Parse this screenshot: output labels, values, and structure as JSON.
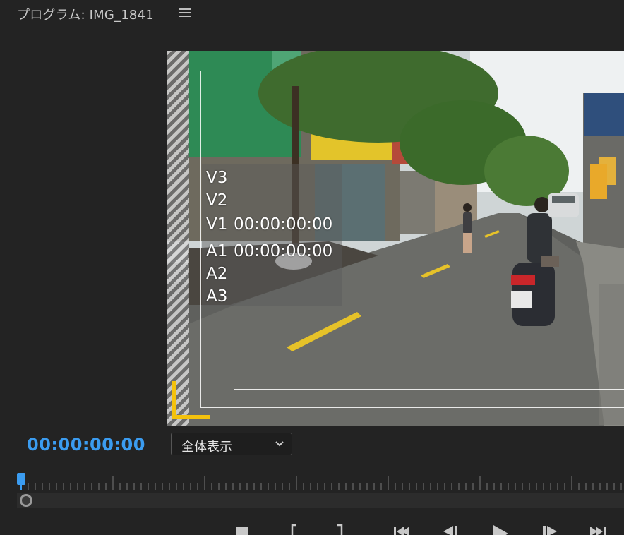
{
  "panel": {
    "title": "プログラム: IMG_1841",
    "menu_icon": "hamburger-menu-icon"
  },
  "monitor": {
    "tracks": [
      {
        "label": "V3",
        "timecode": ""
      },
      {
        "label": "V2",
        "timecode": ""
      },
      {
        "label": "V1",
        "timecode": "00:00:00:00"
      },
      {
        "label": "A1",
        "timecode": "00:00:00:00"
      },
      {
        "label": "A2",
        "timecode": ""
      },
      {
        "label": "A3",
        "timecode": ""
      }
    ]
  },
  "controls": {
    "timecode": "00:00:00:00",
    "timecode_color": "#3b9cf0",
    "zoom_value": "全体表示",
    "zoom_icon": "chevron-down-icon",
    "playhead_position": 0
  },
  "transport": {
    "buttons": [
      "stop-icon",
      "mark-in-icon",
      "mark-out-icon",
      "go-to-in-icon",
      "step-back-icon",
      "play-icon",
      "step-forward-icon",
      "go-to-out-icon"
    ]
  },
  "colors": {
    "background": "#232323",
    "accent": "#3b9cf0",
    "bracket": "#f4c20d"
  }
}
